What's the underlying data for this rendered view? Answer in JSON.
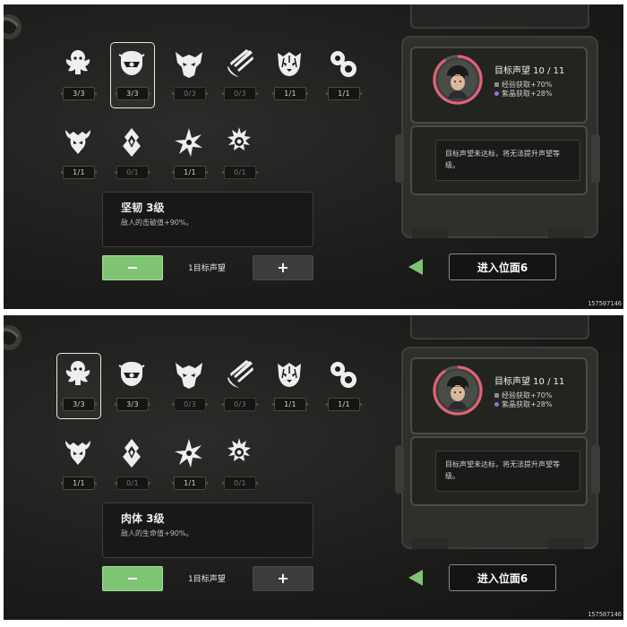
{
  "colors": {
    "accent_green": "#7fc474",
    "rep_ring": "#e8607a",
    "exp_dot": "#8e8e8e",
    "crystal_dot": "#a46ad6"
  },
  "watermark": "157507146",
  "panels": [
    {
      "selected_index": 1,
      "perks": [
        {
          "icon": "skull-crest-icon",
          "count": "3/3",
          "active": true
        },
        {
          "icon": "mask-face-icon",
          "count": "3/3",
          "active": true
        },
        {
          "icon": "demon-mask-icon",
          "count": "0/3",
          "active": false
        },
        {
          "icon": "claw-slash-icon",
          "count": "0/3",
          "active": false
        },
        {
          "icon": "tiger-face-icon",
          "count": "1/1",
          "active": true
        },
        {
          "icon": "spiral-orb-icon",
          "count": "1/1",
          "active": true
        },
        {
          "icon": "horned-beast-icon",
          "count": "1/1",
          "active": true
        },
        {
          "icon": "flame-crystal-icon",
          "count": "0/1",
          "active": false
        },
        {
          "icon": "shuriken-icon",
          "count": "1/1",
          "active": true
        },
        {
          "icon": "sun-spike-icon",
          "count": "0/1",
          "active": false
        }
      ],
      "description": {
        "name": "坚韧 3级",
        "effect": "敌人的击破值+90%。"
      },
      "minus_label": "−",
      "plus_label": "+",
      "target_label": "1目标声望",
      "reputation": {
        "title": "目标声望 10 / 11",
        "progress": 0.91,
        "exp": "经验获取+70%",
        "crystal": "紫晶获取+28%"
      },
      "notice": "目标声望未达标，将无法提升声望等级。",
      "enter_label": "进入位面6"
    },
    {
      "selected_index": 0,
      "perks": [
        {
          "icon": "skull-crest-icon",
          "count": "3/3",
          "active": true
        },
        {
          "icon": "mask-face-icon",
          "count": "3/3",
          "active": true
        },
        {
          "icon": "demon-mask-icon",
          "count": "0/3",
          "active": false
        },
        {
          "icon": "claw-slash-icon",
          "count": "0/3",
          "active": false
        },
        {
          "icon": "tiger-face-icon",
          "count": "1/1",
          "active": true
        },
        {
          "icon": "spiral-orb-icon",
          "count": "1/1",
          "active": true
        },
        {
          "icon": "horned-beast-icon",
          "count": "1/1",
          "active": true
        },
        {
          "icon": "flame-crystal-icon",
          "count": "0/1",
          "active": false
        },
        {
          "icon": "shuriken-icon",
          "count": "1/1",
          "active": true
        },
        {
          "icon": "sun-spike-icon",
          "count": "0/1",
          "active": false
        }
      ],
      "description": {
        "name": "肉体 3级",
        "effect": "敌人的生命值+90%。"
      },
      "minus_label": "−",
      "plus_label": "+",
      "target_label": "1目标声望",
      "reputation": {
        "title": "目标声望 10 / 11",
        "progress": 0.91,
        "exp": "经验获取+70%",
        "crystal": "紫晶获取+28%"
      },
      "notice": "目标声望未达标，将无法提升声望等级。",
      "enter_label": "进入位面6"
    }
  ]
}
